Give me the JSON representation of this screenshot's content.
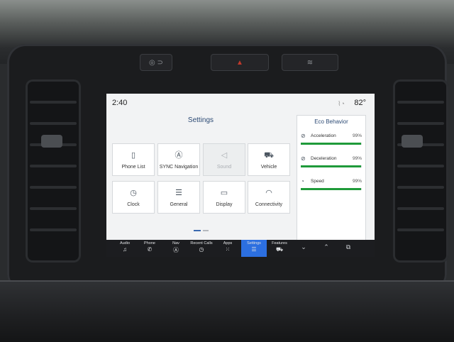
{
  "status": {
    "time": "2:40",
    "temperature": "82°",
    "signal_icon": "signal-icon"
  },
  "settings": {
    "title": "Settings",
    "tiles": [
      {
        "label": "Phone List",
        "icon": "phone-list-icon",
        "enabled": true
      },
      {
        "label": "SYNC Navigation",
        "icon": "navigation-icon",
        "enabled": true
      },
      {
        "label": "Sound",
        "icon": "speaker-icon",
        "enabled": false
      },
      {
        "label": "Vehicle",
        "icon": "vehicle-icon",
        "enabled": true
      },
      {
        "label": "Clock",
        "icon": "clock-icon",
        "enabled": true
      },
      {
        "label": "General",
        "icon": "sliders-icon",
        "enabled": true
      },
      {
        "label": "Display",
        "icon": "display-icon",
        "enabled": true
      },
      {
        "label": "Connectivity",
        "icon": "wifi-icon",
        "enabled": true
      }
    ],
    "page_count": 2,
    "current_page": 1
  },
  "eco": {
    "title": "Eco Behavior",
    "metrics": [
      {
        "label": "Acceleration",
        "value": "99%",
        "fraction": 0.99,
        "icon": "acceleration-icon"
      },
      {
        "label": "Deceleration",
        "value": "99%",
        "fraction": 0.99,
        "icon": "deceleration-icon"
      },
      {
        "label": "Speed",
        "value": "99%",
        "fraction": 0.99,
        "icon": "speed-icon"
      }
    ],
    "bar_color": "#1f9a3a"
  },
  "nav": {
    "items": [
      {
        "label": "Audio",
        "icon": "music-note-icon",
        "active": false
      },
      {
        "label": "Phone",
        "icon": "phone-icon",
        "active": false
      },
      {
        "label": "Nav",
        "icon": "navigation-icon",
        "active": false
      },
      {
        "label": "Recent Calls",
        "icon": "clock-icon",
        "active": false
      },
      {
        "label": "Apps",
        "icon": "apps-grid-icon",
        "active": false
      },
      {
        "label": "Settings",
        "icon": "sliders-icon",
        "active": true
      },
      {
        "label": "Features",
        "icon": "truck-icon",
        "active": false
      }
    ],
    "controls": [
      "chevron-down-icon",
      "chevron-up-icon",
      "window-switch-icon"
    ],
    "accent_color": "#2c6fe0"
  }
}
